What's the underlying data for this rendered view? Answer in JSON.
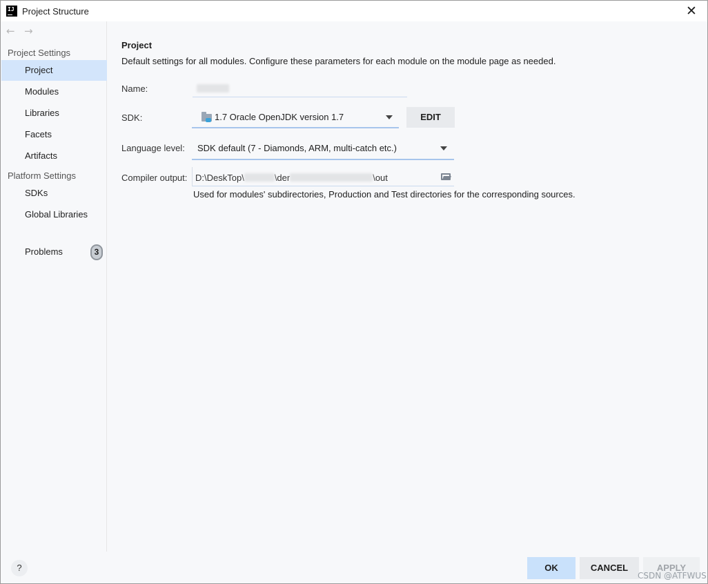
{
  "window": {
    "title": "Project Structure",
    "app_icon_text": "IJ"
  },
  "sidebar": {
    "nav_back": "←",
    "nav_forward": "→",
    "group1": "Project Settings",
    "group1_items": [
      "Project",
      "Modules",
      "Libraries",
      "Facets",
      "Artifacts"
    ],
    "selected": "Project",
    "group2": "Platform Settings",
    "group2_items": [
      "SDKs",
      "Global Libraries"
    ],
    "problems": {
      "label": "Problems",
      "count": "3"
    }
  },
  "main": {
    "title": "Project",
    "description": "Default settings for all modules. Configure these parameters for each module on the module page as needed.",
    "name_label": "Name:",
    "sdk_label": "SDK:",
    "sdk_value": "1.7 Oracle OpenJDK version 1.7",
    "edit_button": "EDIT",
    "language_label": "Language level:",
    "language_value": "SDK default (7 - Diamonds, ARM, multi-catch etc.)",
    "compiler_label": "Compiler output:",
    "compiler_value_prefix": "D:\\DeskTop\\",
    "compiler_value_mid": "\\der",
    "compiler_value_suffix": "\\out",
    "compiler_hint": "Used for modules' subdirectories, Production and Test directories for the corresponding sources."
  },
  "footer": {
    "help": "?",
    "ok": "OK",
    "cancel": "CANCEL",
    "apply": "APPLY",
    "watermark": "CSDN @ATFWUS"
  },
  "colors": {
    "selection": "#d3e5fb",
    "ok_button": "#c9e1fb",
    "focus_underline": "#a7c5ec"
  }
}
